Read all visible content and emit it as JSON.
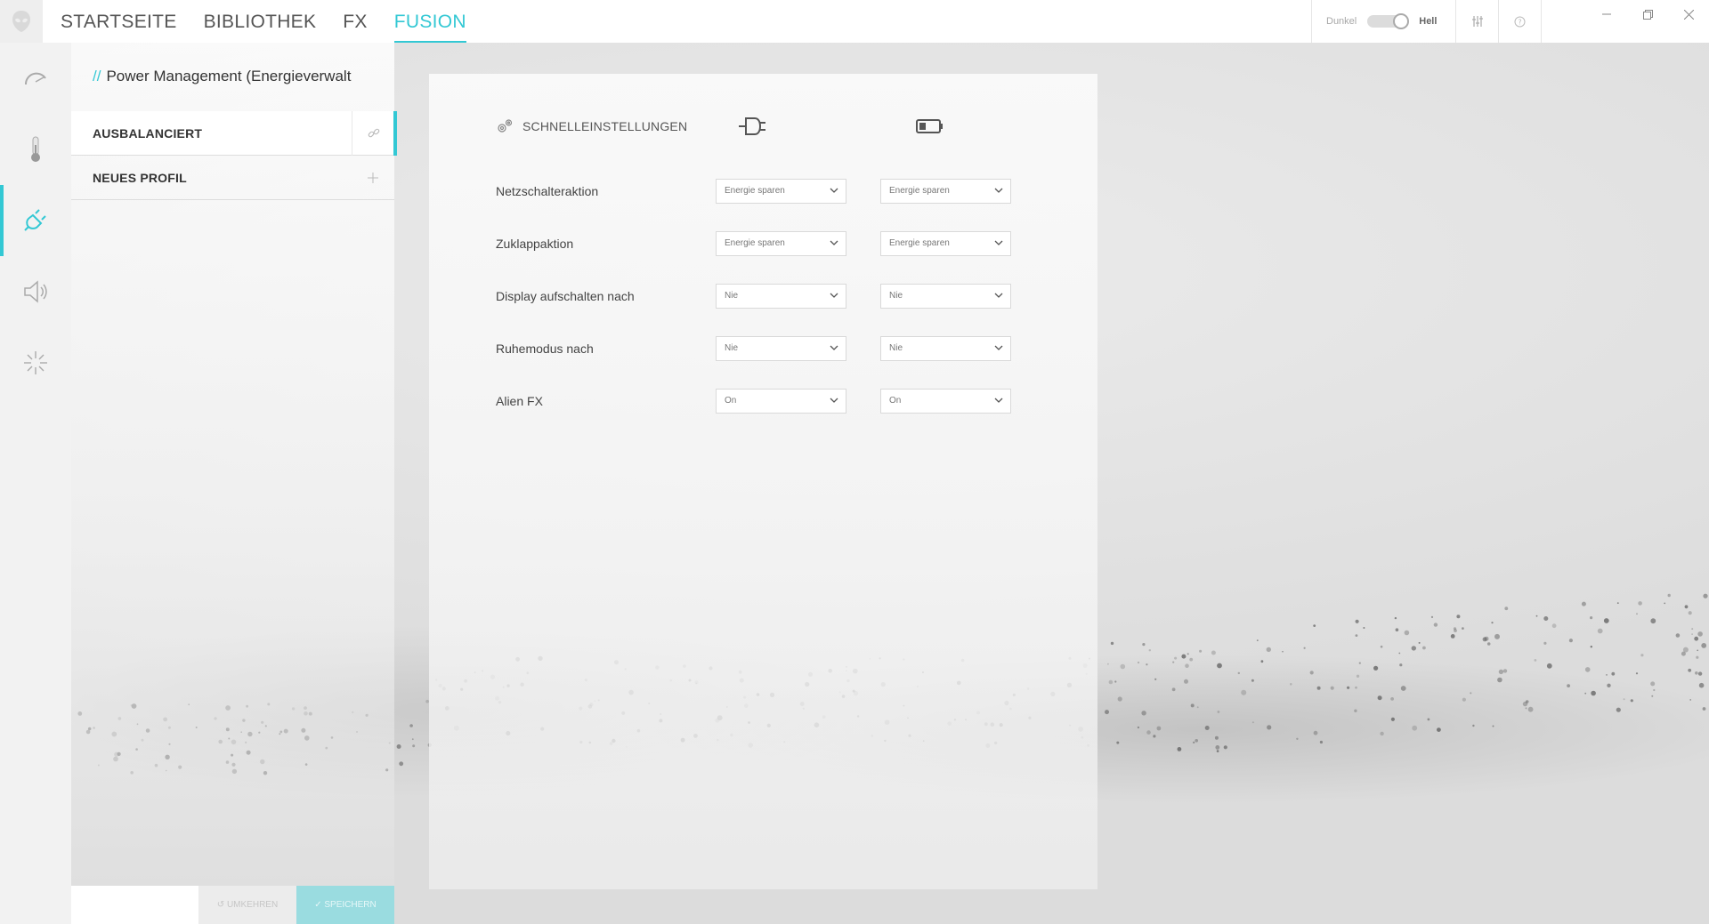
{
  "nav": {
    "items": [
      "STARTSEITE",
      "BIBLIOTHEK",
      "FX",
      "FUSION"
    ],
    "active_index": 3
  },
  "theme": {
    "dark_label": "Dunkel",
    "light_label": "Hell"
  },
  "rail": {
    "icons": [
      "gauge-icon",
      "thermometer-icon",
      "power-plug-icon",
      "speaker-icon",
      "brightness-icon"
    ],
    "active_index": 2
  },
  "sidebar": {
    "title_prefix": "//",
    "title": "Power Management (Energieverwalt",
    "profiles": [
      {
        "label": "AUSBALANCIERT",
        "action_icon": "link-icon",
        "active": true
      },
      {
        "label": "NEUES PROFIL",
        "action_icon": "plus-icon",
        "active": false
      }
    ],
    "reset_label": "↺ UMKEHREN",
    "save_label": "✓ SPEICHERN"
  },
  "panel": {
    "quick_settings_label": "SCHNELLEINSTELLUNGEN",
    "column_icons": [
      "power-plug-icon",
      "battery-icon"
    ],
    "rows": [
      {
        "label": "Netzschalteraktion",
        "ac": "Energie sparen",
        "battery": "Energie sparen"
      },
      {
        "label": "Zuklappaktion",
        "ac": "Energie sparen",
        "battery": "Energie sparen"
      },
      {
        "label": "Display aufschalten nach",
        "ac": "Nie",
        "battery": "Nie"
      },
      {
        "label": "Ruhemodus nach",
        "ac": "Nie",
        "battery": "Nie"
      },
      {
        "label": "Alien FX",
        "ac": "On",
        "battery": "On"
      }
    ]
  },
  "colors": {
    "accent": "#33c8d4"
  }
}
